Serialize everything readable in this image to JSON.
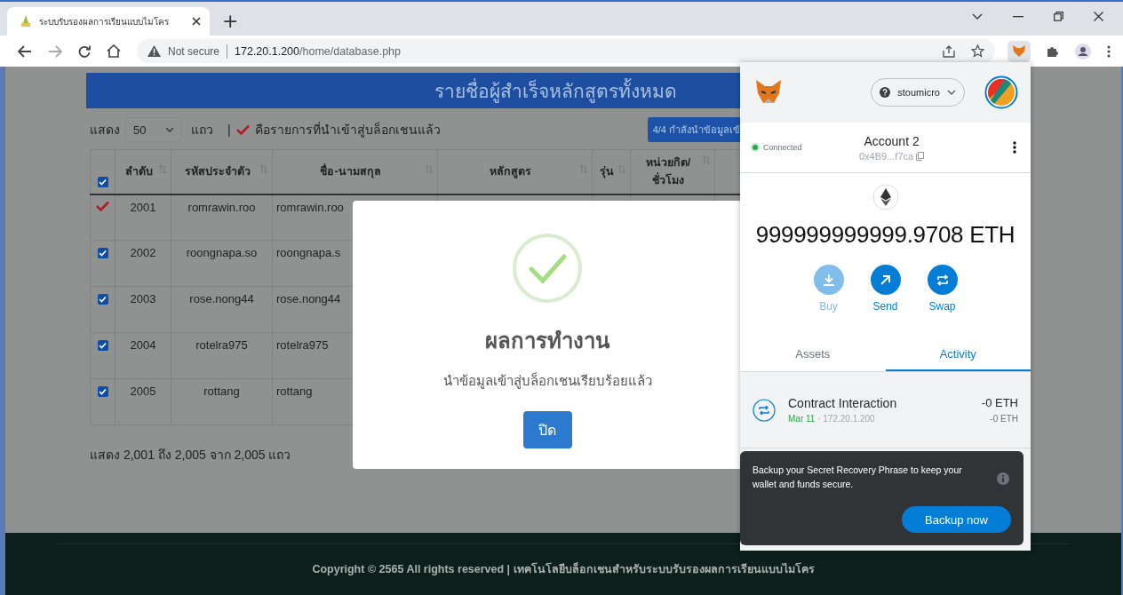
{
  "browser": {
    "tab_title": "ระบบรับรองผลการเรียนแบบไมโคร",
    "new_tab": "+",
    "security": "Not secure",
    "url_host": "172.20.1.200",
    "url_path": "/home/database.php"
  },
  "page": {
    "heading": "รายชื่อผู้สำเร็จหลักสูตรทั้งหมด",
    "show_label": "แสดง",
    "page_size": "50",
    "rows_label": "แถว",
    "separator": "|",
    "legend": "คือรายการที่นำเข้าสู่บล็อกเชนแล้ว",
    "progress_button": "4/4 กำลังนำข้อมูลเข้",
    "table": {
      "select_all_checked": true,
      "columns": [
        {
          "label": "ลำดับ"
        },
        {
          "label": "รหัสประจำตัว"
        },
        {
          "label": "ชื่อ-นามสกุล"
        },
        {
          "label": "หลักสูตร"
        },
        {
          "label": "รุ่น"
        },
        {
          "label": "หน่วยกิต/ ชั่วโมง"
        }
      ],
      "rows": [
        {
          "kind": "imported",
          "no": "2001",
          "id": "romrawin.roo",
          "name": "romrawin.roo"
        },
        {
          "kind": "checkbox",
          "checked": true,
          "no": "2002",
          "id": "roongnapa.so",
          "name": "roongnapa.s"
        },
        {
          "kind": "checkbox",
          "checked": true,
          "no": "2003",
          "id": "rose.nong44",
          "name": "rose.nong44"
        },
        {
          "kind": "checkbox",
          "checked": true,
          "no": "2004",
          "id": "rotelra975",
          "name": "rotelra975"
        },
        {
          "kind": "checkbox",
          "checked": true,
          "no": "2005",
          "id": "rottang",
          "name": "rottang"
        }
      ]
    },
    "summary": "แสดง 2,001 ถึง 2,005 จาก 2,005 แถว"
  },
  "dialog": {
    "title": "ผลการทำงาน",
    "message": "นำข้อมูลเข้าสู่บล็อกเชนเรียบร้อยแล้ว",
    "button": "ปิด"
  },
  "wallet": {
    "network": "stoumicro",
    "status": "Connected",
    "account": "Account 2",
    "address": "0x4B9...f7ca",
    "balance": "999999999999.9708 ETH",
    "actions": [
      {
        "kind": "buy",
        "label": "Buy",
        "disabled": true
      },
      {
        "kind": "send",
        "label": "Send",
        "disabled": false
      },
      {
        "kind": "swap",
        "label": "Swap",
        "disabled": false
      }
    ],
    "tabs": [
      {
        "label": "Assets",
        "selected": false
      },
      {
        "label": "Activity",
        "selected": true
      }
    ],
    "activity": [
      {
        "title": "Contract Interaction",
        "date": "Mar 11",
        "origin": "· 172.20.1.200",
        "amount": "-0 ETH",
        "fiat": "-0 ETH"
      }
    ],
    "backup": {
      "message": "Backup your Secret Recovery Phrase to keep your wallet and funds secure.",
      "button": "Backup now"
    }
  },
  "footer": "Copyright © 2565 All rights reserved | เทคโนโลยีบล็อกเชนสำหรับระบบรับรองผลการเรียนแบบไมโคร"
}
